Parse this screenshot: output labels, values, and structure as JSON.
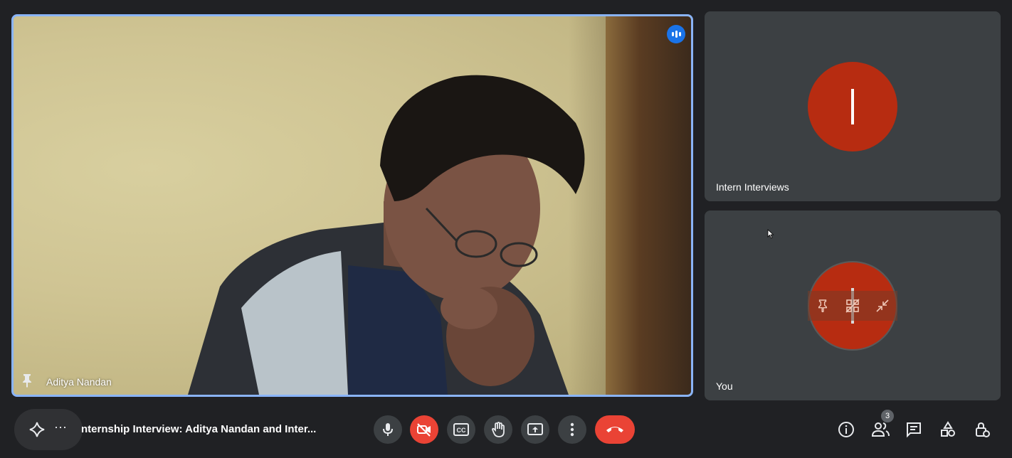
{
  "main_tile": {
    "participant_name": "Aditya Nandan",
    "speaking": true
  },
  "tiles": [
    {
      "name": "Intern Interviews",
      "initial": "I",
      "avatar_color": "#b72c11"
    },
    {
      "name": "You",
      "initial": "I",
      "avatar_color": "#b72c11"
    }
  ],
  "bottom_bar": {
    "meeting_title": "nternship Interview: Aditya Nandan and Inter...",
    "more_label": "⋯",
    "participants_count": "3",
    "icons": {
      "activity": "sparkle-icon",
      "mic": "mic-icon",
      "camera": "camera-off-icon",
      "captions": "captions-icon",
      "hand": "raise-hand-icon",
      "present": "present-icon",
      "more": "more-vert-icon",
      "leave": "end-call-icon",
      "info": "info-icon",
      "people": "people-icon",
      "chat": "chat-icon",
      "activities": "activities-icon",
      "host": "host-controls-icon"
    }
  },
  "colors": {
    "accent": "#8ab4f8",
    "danger": "#ea4335",
    "tile_bg": "#3c4043",
    "page_bg": "#202124"
  }
}
